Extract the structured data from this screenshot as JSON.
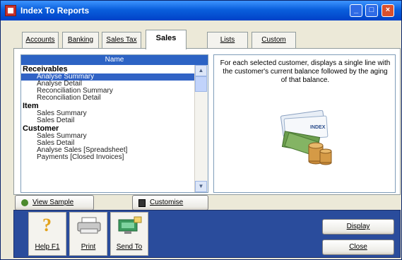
{
  "window": {
    "title": "Index To Reports",
    "controls": {
      "minimize": "_",
      "maximize": "□",
      "close": "×"
    }
  },
  "tabs": [
    {
      "label": "Accounts"
    },
    {
      "label": "Banking"
    },
    {
      "label": "Sales Tax"
    },
    {
      "label": "Sales",
      "active": true
    },
    {
      "label": "Lists"
    },
    {
      "label": "Custom"
    }
  ],
  "report_list": {
    "header": "Name",
    "groups": [
      {
        "title": "Receivables",
        "items": [
          "Analyse Summary",
          "Analyse Detail",
          "Reconciliation Summary",
          "Reconciliation Detail"
        ],
        "selected_index": 0
      },
      {
        "title": "Item",
        "items": [
          "Sales Summary",
          "Sales Detail"
        ]
      },
      {
        "title": "Customer",
        "items": [
          "Sales Summary",
          "Sales Detail",
          "Analyse Sales [Spreadsheet]",
          "Payments [Closed Invoices]"
        ]
      }
    ],
    "scroll": {
      "up": "▲",
      "down": "▼"
    }
  },
  "description": {
    "text": "For each selected customer, displays a single line with the customer's current balance followed by the aging of that balance.",
    "image_name": "money-report-illustration"
  },
  "buttons": {
    "view_sample": "View Sample",
    "customise": "Customise",
    "display": "Display",
    "close": "Close"
  },
  "toolbar": [
    {
      "label": "Help F1",
      "icon": "help-icon"
    },
    {
      "label": "Print",
      "icon": "printer-icon"
    },
    {
      "label": "Send To",
      "icon": "send-to-icon"
    }
  ],
  "colors": {
    "titlebar": "#0A5FDC",
    "selection": "#3163C5",
    "toolbar_bg": "#2A4C9C"
  }
}
